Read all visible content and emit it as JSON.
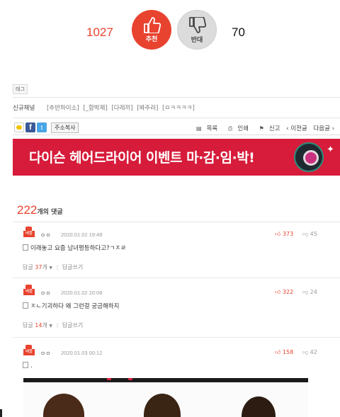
{
  "votes": {
    "up_count": "1027",
    "up_label": "추천",
    "down_label": "반대",
    "down_count": "70"
  },
  "tag_badge": "태그",
  "new_channel": {
    "label": "신규채널",
    "links": [
      "[추반하이소]",
      "[_합박제]",
      "[다레끼]",
      "[봐주라]",
      "[ㅁㅋㅋㅋㅋ]"
    ]
  },
  "share": {
    "copy_url": "주소복사",
    "list": "목록",
    "print": "인쇄",
    "report": "신고",
    "prev": "‹ 이전글",
    "next": "다음글 ›"
  },
  "banner": {
    "text": "다이슨 헤어드라이어 이벤트 마·감·임·박!"
  },
  "comments_header": {
    "count": "222",
    "label": "개의 댓글"
  },
  "comments": [
    {
      "badge": "베플",
      "user": "ㅇㅇ",
      "date": "2020.01.02 19:48",
      "up": "373",
      "down": "45",
      "body": "이래놓고 요즘 남녀평등하다고?ㄱㅈㄹ",
      "reply_label": "답글",
      "reply_count": "37",
      "reply_unit": "개",
      "write_reply": "답글쓰기"
    },
    {
      "badge": "베플",
      "user": "ㅇㅇ",
      "date": "2020.01.02 20:08",
      "up": "322",
      "down": "24",
      "body": "ㅈㄴ기괴하다 왜 그런걸 궁금해하지",
      "reply_label": "답글",
      "reply_count": "14",
      "reply_unit": "개",
      "write_reply": "답글쓰기"
    },
    {
      "badge": "베플",
      "user": "ㅇㅇ",
      "date": "2020.01.03 00:12",
      "up": "158",
      "down": "42",
      "body": "."
    }
  ],
  "colors": {
    "accent_red": "#e8432f",
    "banner_red": "#d61c3a",
    "facebook_blue": "#3b5998",
    "twitter_blue": "#4aa5e6"
  }
}
